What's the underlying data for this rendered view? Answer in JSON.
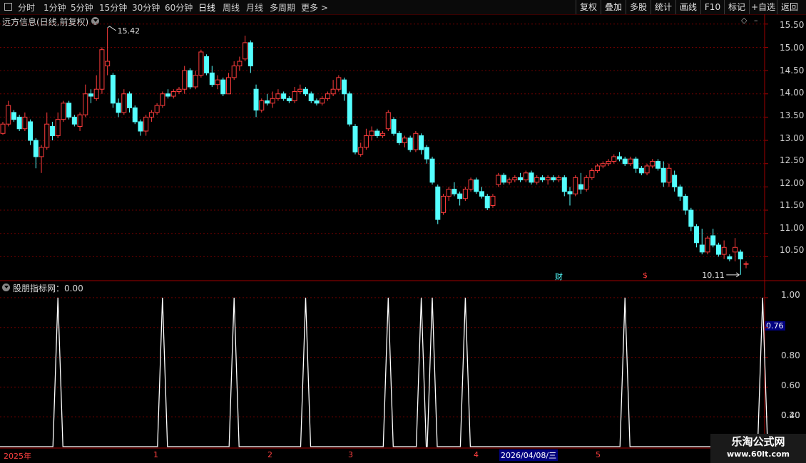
{
  "toolbar": {
    "periods": [
      "分时",
      "1分钟",
      "5分钟",
      "15分钟",
      "30分钟",
      "60分钟",
      "日线",
      "周线",
      "月线",
      "多周期",
      "更多 >"
    ],
    "active_period": "日线",
    "right_buttons": [
      "复权",
      "叠加",
      "多股",
      "统计",
      "画线",
      "F10",
      "标记",
      "+自选",
      "返回"
    ]
  },
  "main_panel": {
    "title": "远方信息(日线,前复权)",
    "high_label": "15.42",
    "low_label": "10.11",
    "y_ticks": [
      "15.50",
      "15.00",
      "14.50",
      "14.00",
      "13.50",
      "13.00",
      "12.50",
      "12.00",
      "11.50",
      "11.00",
      "10.50"
    ],
    "markers": {
      "cai": "财",
      "dollar": "$"
    }
  },
  "indicator_panel": {
    "title": "股朋指标网：0.00",
    "y_ticks": [
      "1.00",
      "0.80",
      "0.60",
      "0.40",
      "0.20"
    ],
    "current_value": "0.76"
  },
  "date_axis": {
    "labels": [
      "2025年",
      "1",
      "2",
      "3",
      "4",
      "5"
    ],
    "crosshair_date": "2026/04/08/三"
  },
  "watermark": {
    "title": "乐淘公式网",
    "url": "www.60lt.com"
  },
  "colors": {
    "up": "#ff3c3c",
    "down": "#54ffff",
    "grid": "#6e0000",
    "axis": "#a00000"
  },
  "chart_data": {
    "type": "candlestick",
    "price_range": [
      10.0,
      15.65
    ],
    "candles": [
      [
        13.15,
        13.35,
        13.12,
        13.4
      ],
      [
        13.35,
        13.75,
        13.3,
        13.85
      ],
      [
        13.6,
        13.45,
        13.4,
        13.65
      ],
      [
        13.5,
        13.25,
        13.2,
        13.55
      ],
      [
        13.25,
        13.5,
        13.2,
        13.6
      ],
      [
        13.4,
        13.0,
        12.9,
        13.45
      ],
      [
        13.0,
        12.65,
        12.4,
        13.05
      ],
      [
        12.65,
        12.85,
        12.3,
        12.9
      ],
      [
        12.85,
        13.35,
        12.8,
        13.6
      ],
      [
        13.3,
        13.1,
        13.0,
        13.4
      ],
      [
        13.1,
        13.45,
        13.05,
        13.6
      ],
      [
        13.45,
        13.8,
        13.4,
        13.85
      ],
      [
        13.8,
        13.5,
        13.45,
        13.85
      ],
      [
        13.5,
        13.35,
        13.3,
        13.55
      ],
      [
        13.3,
        13.55,
        13.2,
        13.6
      ],
      [
        13.55,
        14.0,
        13.5,
        14.2
      ],
      [
        14.0,
        13.95,
        13.8,
        14.1
      ],
      [
        13.9,
        14.1,
        13.85,
        14.4
      ],
      [
        14.1,
        14.95,
        14.0,
        15.0
      ],
      [
        14.6,
        14.7,
        14.4,
        15.42
      ],
      [
        14.4,
        13.8,
        13.7,
        14.45
      ],
      [
        13.8,
        13.6,
        13.5,
        13.9
      ],
      [
        13.6,
        14.0,
        13.55,
        14.1
      ],
      [
        14.0,
        13.7,
        13.6,
        14.05
      ],
      [
        13.7,
        13.4,
        13.35,
        13.75
      ],
      [
        13.4,
        13.2,
        13.1,
        13.45
      ],
      [
        13.2,
        13.5,
        13.1,
        13.55
      ],
      [
        13.5,
        13.6,
        13.4,
        13.65
      ],
      [
        13.6,
        13.75,
        13.55,
        13.8
      ],
      [
        13.75,
        14.0,
        13.7,
        14.05
      ],
      [
        14.0,
        13.95,
        13.9,
        14.1
      ],
      [
        13.95,
        14.05,
        13.9,
        14.1
      ],
      [
        14.05,
        14.1,
        14.0,
        14.15
      ],
      [
        14.1,
        14.5,
        14.0,
        14.6
      ],
      [
        14.5,
        14.15,
        14.1,
        14.55
      ],
      [
        14.15,
        14.4,
        14.1,
        14.5
      ],
      [
        14.4,
        14.9,
        14.35,
        14.95
      ],
      [
        14.8,
        14.45,
        14.4,
        14.85
      ],
      [
        14.45,
        14.2,
        14.15,
        14.6
      ],
      [
        14.2,
        14.3,
        14.1,
        14.4
      ],
      [
        14.3,
        14.0,
        13.95,
        14.35
      ],
      [
        14.0,
        14.35,
        14.0,
        14.45
      ],
      [
        14.35,
        14.6,
        14.3,
        14.7
      ],
      [
        14.6,
        14.7,
        14.5,
        14.8
      ],
      [
        14.75,
        15.1,
        14.7,
        15.25
      ],
      [
        15.1,
        14.6,
        14.45,
        15.15
      ],
      [
        14.1,
        13.65,
        13.5,
        14.2
      ],
      [
        13.65,
        13.85,
        13.6,
        13.9
      ],
      [
        13.85,
        13.8,
        13.75,
        14.0
      ],
      [
        13.8,
        13.9,
        13.7,
        14.05
      ],
      [
        13.9,
        14.0,
        13.85,
        14.1
      ],
      [
        14.0,
        13.9,
        13.85,
        14.05
      ],
      [
        13.9,
        13.85,
        13.8,
        13.95
      ],
      [
        13.85,
        14.05,
        13.8,
        14.15
      ],
      [
        14.05,
        14.1,
        14.0,
        14.2
      ],
      [
        14.1,
        14.0,
        13.95,
        14.15
      ],
      [
        14.0,
        13.85,
        13.8,
        14.05
      ],
      [
        13.85,
        13.8,
        13.75,
        13.9
      ],
      [
        13.8,
        13.9,
        13.75,
        13.95
      ],
      [
        13.9,
        14.0,
        13.85,
        14.05
      ],
      [
        14.0,
        14.1,
        13.95,
        14.3
      ],
      [
        14.1,
        14.35,
        14.05,
        14.4
      ],
      [
        14.3,
        14.0,
        13.85,
        14.35
      ],
      [
        14.0,
        13.35,
        13.3,
        14.05
      ],
      [
        13.3,
        12.75,
        12.7,
        13.35
      ],
      [
        12.7,
        12.85,
        12.65,
        12.95
      ],
      [
        12.85,
        13.1,
        12.8,
        13.25
      ],
      [
        13.1,
        13.2,
        13.0,
        13.3
      ],
      [
        13.2,
        13.1,
        13.05,
        13.25
      ],
      [
        13.1,
        13.15,
        13.05,
        13.2
      ],
      [
        13.25,
        13.6,
        13.2,
        13.65
      ],
      [
        13.45,
        13.15,
        13.1,
        13.5
      ],
      [
        13.15,
        12.95,
        12.9,
        13.2
      ],
      [
        12.95,
        13.05,
        12.85,
        13.1
      ],
      [
        13.05,
        12.8,
        12.75,
        13.1
      ],
      [
        12.8,
        13.15,
        12.75,
        13.2
      ],
      [
        13.1,
        12.8,
        12.7,
        13.15
      ],
      [
        12.85,
        12.6,
        12.5,
        12.9
      ],
      [
        12.6,
        12.1,
        12.05,
        12.65
      ],
      [
        12.0,
        11.3,
        11.2,
        12.05
      ],
      [
        11.45,
        11.8,
        11.4,
        11.85
      ],
      [
        11.8,
        11.95,
        11.7,
        12.0
      ],
      [
        11.95,
        11.85,
        11.8,
        12.1
      ],
      [
        11.85,
        11.75,
        11.6,
        11.9
      ],
      [
        11.75,
        11.95,
        11.7,
        12.0
      ],
      [
        11.95,
        12.15,
        11.9,
        12.2
      ],
      [
        12.15,
        11.9,
        11.85,
        12.2
      ],
      [
        11.9,
        11.8,
        11.75,
        12.0
      ],
      [
        11.8,
        11.55,
        11.5,
        11.85
      ],
      [
        11.6,
        11.8,
        11.55,
        11.85
      ],
      [
        12.05,
        12.25,
        12.0,
        12.3
      ],
      [
        12.25,
        12.1,
        12.05,
        12.3
      ],
      [
        12.1,
        12.15,
        12.05,
        12.2
      ],
      [
        12.15,
        12.2,
        12.1,
        12.25
      ],
      [
        12.2,
        12.15,
        12.1,
        12.3
      ],
      [
        12.15,
        12.3,
        12.1,
        12.35
      ],
      [
        12.3,
        12.1,
        12.05,
        12.35
      ],
      [
        12.1,
        12.2,
        12.05,
        12.25
      ],
      [
        12.2,
        12.15,
        12.1,
        12.25
      ],
      [
        12.15,
        12.2,
        12.05,
        12.25
      ],
      [
        12.2,
        12.15,
        12.1,
        12.25
      ],
      [
        12.15,
        12.2,
        12.1,
        12.25
      ],
      [
        12.2,
        11.9,
        11.8,
        12.25
      ],
      [
        11.9,
        11.85,
        11.6,
        12.0
      ],
      [
        11.85,
        12.2,
        11.8,
        12.25
      ],
      [
        12.05,
        11.95,
        11.85,
        12.3
      ],
      [
        11.95,
        12.2,
        11.9,
        12.25
      ],
      [
        12.2,
        12.35,
        12.15,
        12.4
      ],
      [
        12.35,
        12.45,
        12.3,
        12.5
      ],
      [
        12.45,
        12.5,
        12.4,
        12.55
      ],
      [
        12.5,
        12.55,
        12.45,
        12.6
      ],
      [
        12.55,
        12.65,
        12.5,
        12.7
      ],
      [
        12.65,
        12.6,
        12.55,
        12.75
      ],
      [
        12.6,
        12.5,
        12.45,
        12.65
      ],
      [
        12.5,
        12.6,
        12.45,
        12.65
      ],
      [
        12.6,
        12.4,
        12.3,
        12.65
      ],
      [
        12.4,
        12.3,
        12.25,
        12.45
      ],
      [
        12.3,
        12.45,
        12.25,
        12.5
      ],
      [
        12.45,
        12.55,
        12.4,
        12.6
      ],
      [
        12.55,
        12.4,
        12.35,
        12.6
      ],
      [
        12.4,
        12.1,
        12.0,
        12.55
      ],
      [
        12.1,
        12.4,
        12.0,
        12.5
      ],
      [
        12.25,
        12.0,
        11.9,
        12.35
      ],
      [
        12.0,
        11.8,
        11.7,
        12.05
      ],
      [
        11.8,
        11.5,
        11.4,
        11.85
      ],
      [
        11.5,
        11.15,
        11.05,
        11.55
      ],
      [
        11.15,
        10.8,
        10.7,
        11.2
      ],
      [
        10.75,
        10.6,
        10.55,
        11.1
      ],
      [
        10.6,
        10.9,
        10.55,
        10.95
      ],
      [
        10.95,
        10.75,
        10.7,
        11.1
      ],
      [
        10.75,
        10.55,
        10.5,
        10.8
      ],
      [
        10.55,
        10.7,
        10.45,
        10.85
      ],
      [
        10.5,
        10.45,
        10.4,
        10.55
      ],
      [
        10.6,
        10.7,
        10.4,
        10.9
      ],
      [
        10.6,
        10.45,
        10.11,
        10.65
      ],
      [
        10.35,
        10.35,
        10.25,
        10.4
      ]
    ],
    "indicator": {
      "name": "股朋指标网",
      "range": [
        0,
        1.1
      ],
      "signal_bars": [
        10,
        29,
        42,
        55,
        70,
        76,
        78,
        84,
        113,
        138
      ]
    }
  }
}
